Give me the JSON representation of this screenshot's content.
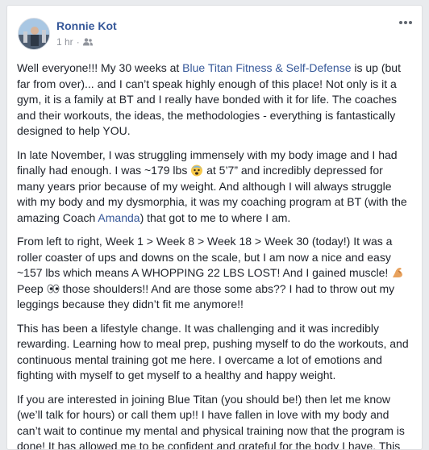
{
  "post": {
    "author": "Ronnie Kot",
    "time": "1 hr",
    "dot": "·",
    "icons": {
      "more": "more-options-icon",
      "audience": "friends-audience-icon"
    },
    "paragraphs": {
      "p1": {
        "a": "Well everyone!!! My 30 weeks at ",
        "link": "Blue Titan Fitness & Self-Defense",
        "b": " is up (but far from over)... and I can’t speak highly enough of this place! Not only is it a gym, it is a family at BT and I really have bonded with it for life. The coaches and their workouts, the ideas, the methodologies - everything is fantastically designed to help YOU."
      },
      "p2": {
        "a": "In late November, I was struggling immensely with my body image and I had finally had enough. I was ~179 lbs ",
        "emoji": "scared-face-emoji",
        "b": " at 5’7” and incredibly depressed for many years prior because of my weight. And although I will always struggle with my body and my dysmorphia, it was my coaching program at BT (with the amazing Coach ",
        "link": "Amanda",
        "c": ") that got to me to where I am."
      },
      "p3": {
        "a": "From left to right, Week 1 > Week 8 > Week 18 > Week 30 (today!) It was a roller coaster of ups and downs on the scale, but I am now a nice and easy ~157 lbs which means A WHOPPING 22 LBS LOST! And I gained muscle! ",
        "emoji1": "flexed-biceps-emoji",
        "b": " Peep ",
        "emoji2": "eyes-emoji",
        "c": " those shoulders!! And are those some abs?? I had to throw out my leggings because they didn’t fit me anymore!!"
      },
      "p4": "This has been a lifestyle change. It was challenging and it was incredibly rewarding. Learning how to meal prep, pushing myself to do the workouts, and continuous mental training got me here. I overcame a lot of emotions and fighting with myself to get myself to a healthy and happy weight.",
      "p5": "If you are interested in joining Blue Titan (you should be!) then let me know (we’ll talk for hours) or call them up!! I have fallen in love with my body and can’t wait to continue my mental and physical training now that the program is done! It has allowed me to be confident and grateful for the body I have. This was no small change - the pictures say it all."
    }
  }
}
